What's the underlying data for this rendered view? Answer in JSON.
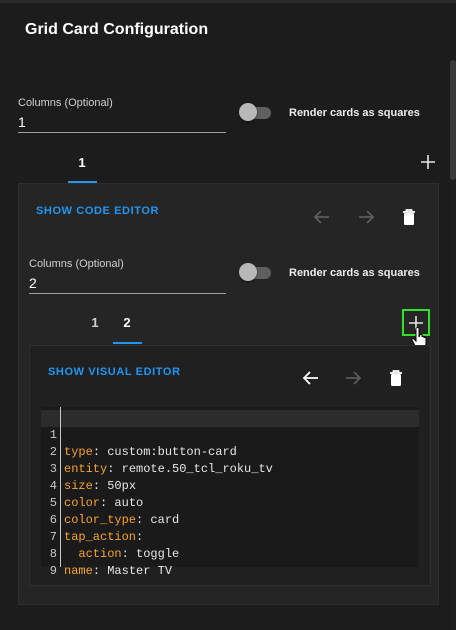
{
  "dialog": {
    "title": "Grid Card Configuration"
  },
  "outer": {
    "columns_label": "Columns (Optional)",
    "columns_value": "1",
    "square_label": "Render cards as squares",
    "tabs": [
      {
        "label": "1",
        "active": true
      }
    ],
    "add_icon": "plus-icon",
    "show_code_editor": "SHOW CODE EDITOR",
    "move_left_icon": "arrow-left-icon",
    "move_right_icon": "arrow-right-icon",
    "delete_icon": "trash-icon"
  },
  "inner": {
    "columns_label": "Columns (Optional)",
    "columns_value": "2",
    "square_label": "Render cards as squares",
    "tabs": [
      {
        "label": "1",
        "active": false
      },
      {
        "label": "2",
        "active": true
      }
    ],
    "add_icon": "plus-icon",
    "show_visual_editor": "SHOW VISUAL EDITOR",
    "move_left_icon": "arrow-left-icon",
    "move_right_icon": "arrow-right-icon",
    "delete_icon": "trash-icon"
  },
  "code_editor": {
    "lines": [
      {
        "num": "1",
        "key": "type",
        "sep": ": ",
        "value": "custom:button-card"
      },
      {
        "num": "2",
        "key": "entity",
        "sep": ": ",
        "value": "remote.50_tcl_roku_tv"
      },
      {
        "num": "3",
        "key": "size",
        "sep": ": ",
        "value": "50px"
      },
      {
        "num": "4",
        "key": "color",
        "sep": ": ",
        "value": "auto"
      },
      {
        "num": "5",
        "key": "color_type",
        "sep": ": ",
        "value": "card"
      },
      {
        "num": "6",
        "key": "tap_action",
        "sep": ":",
        "value": ""
      },
      {
        "num": "7",
        "key": "  action",
        "sep": ": ",
        "value": "toggle"
      },
      {
        "num": "8",
        "key": "name",
        "sep": ": ",
        "value": "Master TV"
      },
      {
        "num": "9",
        "key": "",
        "sep": "",
        "value": ""
      }
    ]
  },
  "colors": {
    "accent": "#2196f3",
    "yaml_key": "#f6a430",
    "highlight": "#32e026"
  }
}
